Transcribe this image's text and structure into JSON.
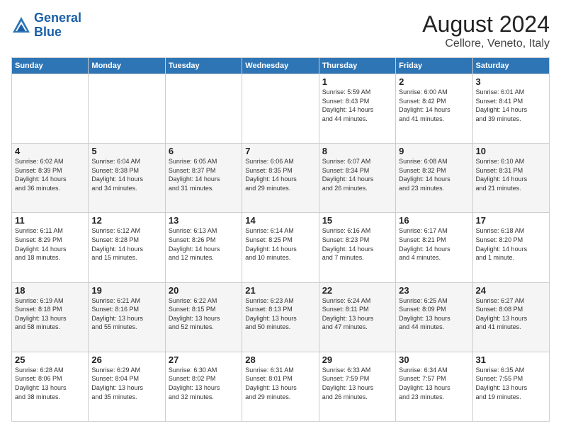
{
  "header": {
    "logo_line1": "General",
    "logo_line2": "Blue",
    "main_title": "August 2024",
    "sub_title": "Cellore, Veneto, Italy"
  },
  "days_of_week": [
    "Sunday",
    "Monday",
    "Tuesday",
    "Wednesday",
    "Thursday",
    "Friday",
    "Saturday"
  ],
  "weeks": [
    [
      {
        "day": "",
        "info": ""
      },
      {
        "day": "",
        "info": ""
      },
      {
        "day": "",
        "info": ""
      },
      {
        "day": "",
        "info": ""
      },
      {
        "day": "1",
        "info": "Sunrise: 5:59 AM\nSunset: 8:43 PM\nDaylight: 14 hours\nand 44 minutes."
      },
      {
        "day": "2",
        "info": "Sunrise: 6:00 AM\nSunset: 8:42 PM\nDaylight: 14 hours\nand 41 minutes."
      },
      {
        "day": "3",
        "info": "Sunrise: 6:01 AM\nSunset: 8:41 PM\nDaylight: 14 hours\nand 39 minutes."
      }
    ],
    [
      {
        "day": "4",
        "info": "Sunrise: 6:02 AM\nSunset: 8:39 PM\nDaylight: 14 hours\nand 36 minutes."
      },
      {
        "day": "5",
        "info": "Sunrise: 6:04 AM\nSunset: 8:38 PM\nDaylight: 14 hours\nand 34 minutes."
      },
      {
        "day": "6",
        "info": "Sunrise: 6:05 AM\nSunset: 8:37 PM\nDaylight: 14 hours\nand 31 minutes."
      },
      {
        "day": "7",
        "info": "Sunrise: 6:06 AM\nSunset: 8:35 PM\nDaylight: 14 hours\nand 29 minutes."
      },
      {
        "day": "8",
        "info": "Sunrise: 6:07 AM\nSunset: 8:34 PM\nDaylight: 14 hours\nand 26 minutes."
      },
      {
        "day": "9",
        "info": "Sunrise: 6:08 AM\nSunset: 8:32 PM\nDaylight: 14 hours\nand 23 minutes."
      },
      {
        "day": "10",
        "info": "Sunrise: 6:10 AM\nSunset: 8:31 PM\nDaylight: 14 hours\nand 21 minutes."
      }
    ],
    [
      {
        "day": "11",
        "info": "Sunrise: 6:11 AM\nSunset: 8:29 PM\nDaylight: 14 hours\nand 18 minutes."
      },
      {
        "day": "12",
        "info": "Sunrise: 6:12 AM\nSunset: 8:28 PM\nDaylight: 14 hours\nand 15 minutes."
      },
      {
        "day": "13",
        "info": "Sunrise: 6:13 AM\nSunset: 8:26 PM\nDaylight: 14 hours\nand 12 minutes."
      },
      {
        "day": "14",
        "info": "Sunrise: 6:14 AM\nSunset: 8:25 PM\nDaylight: 14 hours\nand 10 minutes."
      },
      {
        "day": "15",
        "info": "Sunrise: 6:16 AM\nSunset: 8:23 PM\nDaylight: 14 hours\nand 7 minutes."
      },
      {
        "day": "16",
        "info": "Sunrise: 6:17 AM\nSunset: 8:21 PM\nDaylight: 14 hours\nand 4 minutes."
      },
      {
        "day": "17",
        "info": "Sunrise: 6:18 AM\nSunset: 8:20 PM\nDaylight: 14 hours\nand 1 minute."
      }
    ],
    [
      {
        "day": "18",
        "info": "Sunrise: 6:19 AM\nSunset: 8:18 PM\nDaylight: 13 hours\nand 58 minutes."
      },
      {
        "day": "19",
        "info": "Sunrise: 6:21 AM\nSunset: 8:16 PM\nDaylight: 13 hours\nand 55 minutes."
      },
      {
        "day": "20",
        "info": "Sunrise: 6:22 AM\nSunset: 8:15 PM\nDaylight: 13 hours\nand 52 minutes."
      },
      {
        "day": "21",
        "info": "Sunrise: 6:23 AM\nSunset: 8:13 PM\nDaylight: 13 hours\nand 50 minutes."
      },
      {
        "day": "22",
        "info": "Sunrise: 6:24 AM\nSunset: 8:11 PM\nDaylight: 13 hours\nand 47 minutes."
      },
      {
        "day": "23",
        "info": "Sunrise: 6:25 AM\nSunset: 8:09 PM\nDaylight: 13 hours\nand 44 minutes."
      },
      {
        "day": "24",
        "info": "Sunrise: 6:27 AM\nSunset: 8:08 PM\nDaylight: 13 hours\nand 41 minutes."
      }
    ],
    [
      {
        "day": "25",
        "info": "Sunrise: 6:28 AM\nSunset: 8:06 PM\nDaylight: 13 hours\nand 38 minutes."
      },
      {
        "day": "26",
        "info": "Sunrise: 6:29 AM\nSunset: 8:04 PM\nDaylight: 13 hours\nand 35 minutes."
      },
      {
        "day": "27",
        "info": "Sunrise: 6:30 AM\nSunset: 8:02 PM\nDaylight: 13 hours\nand 32 minutes."
      },
      {
        "day": "28",
        "info": "Sunrise: 6:31 AM\nSunset: 8:01 PM\nDaylight: 13 hours\nand 29 minutes."
      },
      {
        "day": "29",
        "info": "Sunrise: 6:33 AM\nSunset: 7:59 PM\nDaylight: 13 hours\nand 26 minutes."
      },
      {
        "day": "30",
        "info": "Sunrise: 6:34 AM\nSunset: 7:57 PM\nDaylight: 13 hours\nand 23 minutes."
      },
      {
        "day": "31",
        "info": "Sunrise: 6:35 AM\nSunset: 7:55 PM\nDaylight: 13 hours\nand 19 minutes."
      }
    ]
  ]
}
